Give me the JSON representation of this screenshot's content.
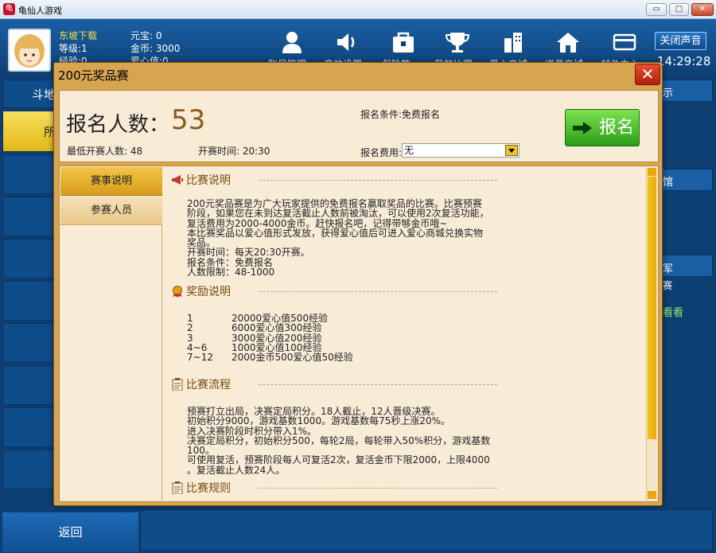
{
  "window": {
    "title": "龟仙人游戏",
    "icon_glyph": "龟"
  },
  "user": {
    "name": "东坡下载",
    "level": "等级:1",
    "exp": "经验:0",
    "yuanbao": "元宝: 0",
    "gold": "金币: 3000",
    "love": "爱心值:0"
  },
  "nav": {
    "labels": [
      "账号管理",
      "音效设置",
      "保险箱",
      "我的比赛",
      "爱心商城",
      "道具商城",
      "邮件中心"
    ]
  },
  "header": {
    "mute_label": "关闭声音",
    "clock": "14:29:28"
  },
  "background": {
    "left_title": "斗地",
    "left_tab": "所",
    "right_texts": [
      "示",
      "馆",
      "军",
      "赛",
      "看看"
    ],
    "back_label": "返回"
  },
  "dialog": {
    "title": "200元奖品赛",
    "close_label": "✕",
    "reg_label": "报名人数：",
    "reg_count": "53",
    "min_players": "最低开赛人数: 48",
    "start_time": "开赛时间:  20:30",
    "condition": "报名条件:免费报名",
    "fee_label": "报名费用:",
    "fee_value": "无",
    "signup_label": "报名",
    "tabs": [
      "赛事说明",
      "参赛人员"
    ],
    "sections": {
      "desc_title": "比赛说明",
      "desc_lines": [
        "200元奖品赛是为广大玩家提供的免费报名赢取奖品的比赛。比赛预赛",
        "阶段，如果您在未到达复活截止人数前被淘汰，可以使用2次复活功能，",
        "复活费用为2000-4000金币。赶快报名吧，记得带够金币哦~",
        "本比赛奖品以爱心值形式发放，获得爱心值后可进入爱心商城兑换实物",
        "奖品。",
        "开赛时间：每天20:30开赛。",
        "报名条件：免费报名",
        "人数限制：48-1000"
      ],
      "reward_title": "奖励说明",
      "rewards": [
        {
          "rank": "1",
          "prize": "20000爱心值500经验"
        },
        {
          "rank": "2",
          "prize": "6000爱心值300经验"
        },
        {
          "rank": "3",
          "prize": "3000爱心值200经验"
        },
        {
          "rank": "4~6",
          "prize": "1000爱心值100经验"
        },
        {
          "rank": "7~12",
          "prize": "2000金币500爱心值50经验"
        }
      ],
      "flow_title": "比赛流程",
      "flow_lines": [
        "预赛打立出局，决赛定局积分。18人截止，12人晋级决赛。",
        "初始积分9000，游戏基数1000。游戏基数每75秒上涨20%。",
        "进入决赛阶段时积分带入1%。",
        "决赛定局积分，初始积分500，每轮2局，每轮带入50%积分，游戏基数",
        "100。",
        "可使用复活，预赛阶段每人可复活2次，复活金币下限2000，上限4000",
        "。复活截止人数24人。"
      ],
      "rules_title": "比赛规则"
    }
  },
  "colors": {
    "dialog_bg": "#d7a54f",
    "panel_bg": "#f8ecd7",
    "accent_gold": "#8b5a1e",
    "signup_green": "#2c9d1a",
    "close_red": "#c7442b",
    "bg_blue": "#0d3f73"
  }
}
